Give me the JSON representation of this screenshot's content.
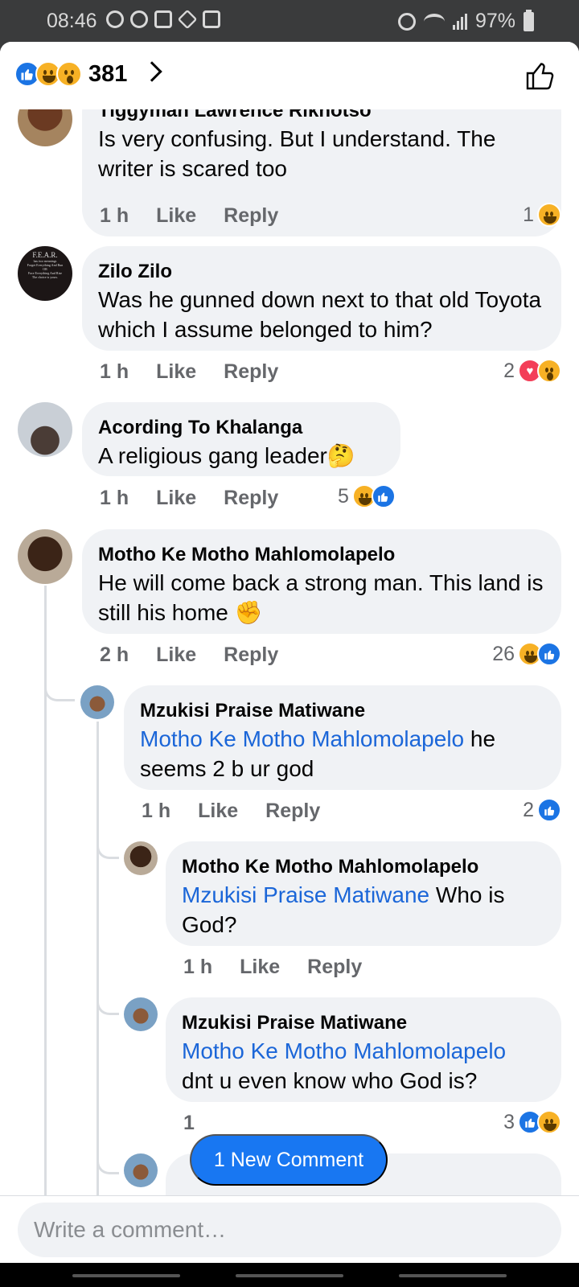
{
  "status_bar": {
    "time": "08:46",
    "battery": "97%"
  },
  "header": {
    "reaction_count": "381",
    "reactions": [
      "like-icon",
      "haha-icon",
      "wow-icon"
    ]
  },
  "comments": [
    {
      "author": "Tiggyman Lawrence Rikhotso",
      "text": "Is very confusing. But I understand. The writer is scared too",
      "time": "1 h",
      "like": "Like",
      "reply": "Reply",
      "reaction_count": "1"
    },
    {
      "author": "Zilo Zilo",
      "text": "Was he gunned down next to that old Toyota which I assume belonged to him?",
      "time": "1 h",
      "like": "Like",
      "reply": "Reply",
      "reaction_count": "2",
      "avatar_text": {
        "title": "F.E.A.R.",
        "l1": "has two meanings",
        "l2": "Forget Everything And Run",
        "l3": "OR",
        "l4": "Face Everything And Rise",
        "l5": "The choice is yours."
      }
    },
    {
      "author": "Acording To Khalanga",
      "text": "A religious gang leader",
      "emoji": "🤔",
      "time": "1 h",
      "like": "Like",
      "reply": "Reply",
      "reaction_count": "5"
    },
    {
      "author": "Motho Ke Motho Mahlomolapelo",
      "text": "He will come back a strong man. This land is still his home",
      "emoji": "✊",
      "time": "2 h",
      "like": "Like",
      "reply": "Reply",
      "reaction_count": "26"
    },
    {
      "author": "Mzukisi Praise Matiwane",
      "mention": "Motho Ke Motho Mahlomolapelo",
      "text_a": " he",
      "text_b": "seems 2 b ur god",
      "time": "1 h",
      "like": "Like",
      "reply": "Reply",
      "reaction_count": "2"
    },
    {
      "author": "Motho Ke Motho Mahlomolapelo",
      "mention": "Mzukisi Praise Matiwane",
      "text_a": " Who is",
      "text_b": "God?",
      "time": "1 h",
      "like": "Like",
      "reply": "Reply"
    },
    {
      "author": "Mzukisi Praise Matiwane",
      "mention": "Motho Ke Motho Mahlomolapelo",
      "text": "dnt u even know who God is?",
      "time": "1",
      "reaction_count": "3"
    }
  ],
  "new_comment_button": "1 New Comment",
  "composer": {
    "placeholder": "Write a comment…"
  },
  "colors": {
    "accent": "#1877f2",
    "mention": "#1b66d8",
    "bubble": "#f0f2f5"
  }
}
